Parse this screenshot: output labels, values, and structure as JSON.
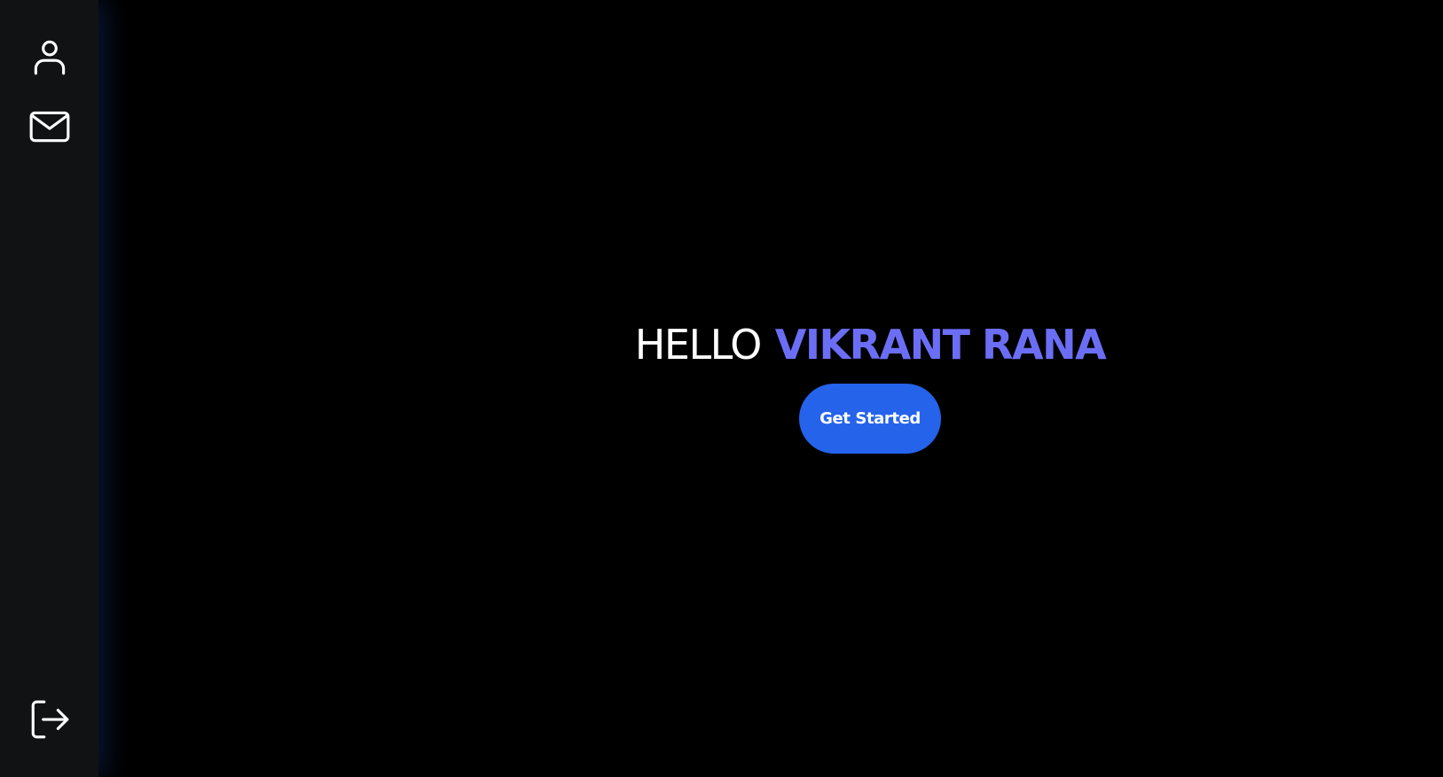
{
  "sidebar": {
    "top_items": [
      {
        "icon": "user-icon",
        "action": "profile"
      },
      {
        "icon": "mail-icon",
        "action": "messages"
      }
    ],
    "bottom_items": [
      {
        "icon": "logout-icon",
        "action": "logout"
      }
    ]
  },
  "hero": {
    "greeting": "HELLO",
    "name": "VIKRANT RANA",
    "cta_label": "Get Started"
  },
  "colors": {
    "background": "#000000",
    "sidebar_background": "#111214",
    "accent_name": "#6b6ef5",
    "button": "#2563eb",
    "text": "#ffffff"
  }
}
